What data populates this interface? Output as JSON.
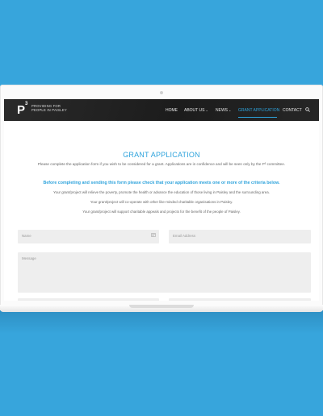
{
  "site": {
    "logo_letter": "P",
    "logo_sup": "3",
    "tagline": "PROVIDING FOR PEOPLE IN PAISLEY"
  },
  "nav": {
    "items": [
      {
        "label": "HOME"
      },
      {
        "label": "ABOUT US",
        "chevron": "⌄"
      },
      {
        "label": "NEWS",
        "chevron": "⌄"
      },
      {
        "label": "GRANT APPLICATION"
      },
      {
        "label": "CONTACT"
      }
    ],
    "active": "GRANT APPLICATION"
  },
  "page": {
    "title": "GRANT APPLICATION",
    "intro": "Please complete the application form if you wish to be considered for a grant. Applications are in confidence and will be seen only by the P³ committee.",
    "criteria_heading": "Before completing and sending this form please check that your application meets one or more of the criteria below.",
    "criteria": [
      "Your grant/project will relieve the poverty, promote the health or advance the education of those living in Paisley and the surrounding area.",
      "Your grant/project will co-operate with other like-minded charitable organisations in Paisley.",
      "Your grant/project will support charitable appeals and projects for the benefit of the people of Paisley."
    ]
  },
  "form": {
    "name_placeholder": "Name",
    "email_placeholder": "Email Address",
    "message_placeholder": "Message"
  },
  "colors": {
    "background": "#37a5dc",
    "accent": "#2ea3dc",
    "header": "#1f1f1f"
  }
}
